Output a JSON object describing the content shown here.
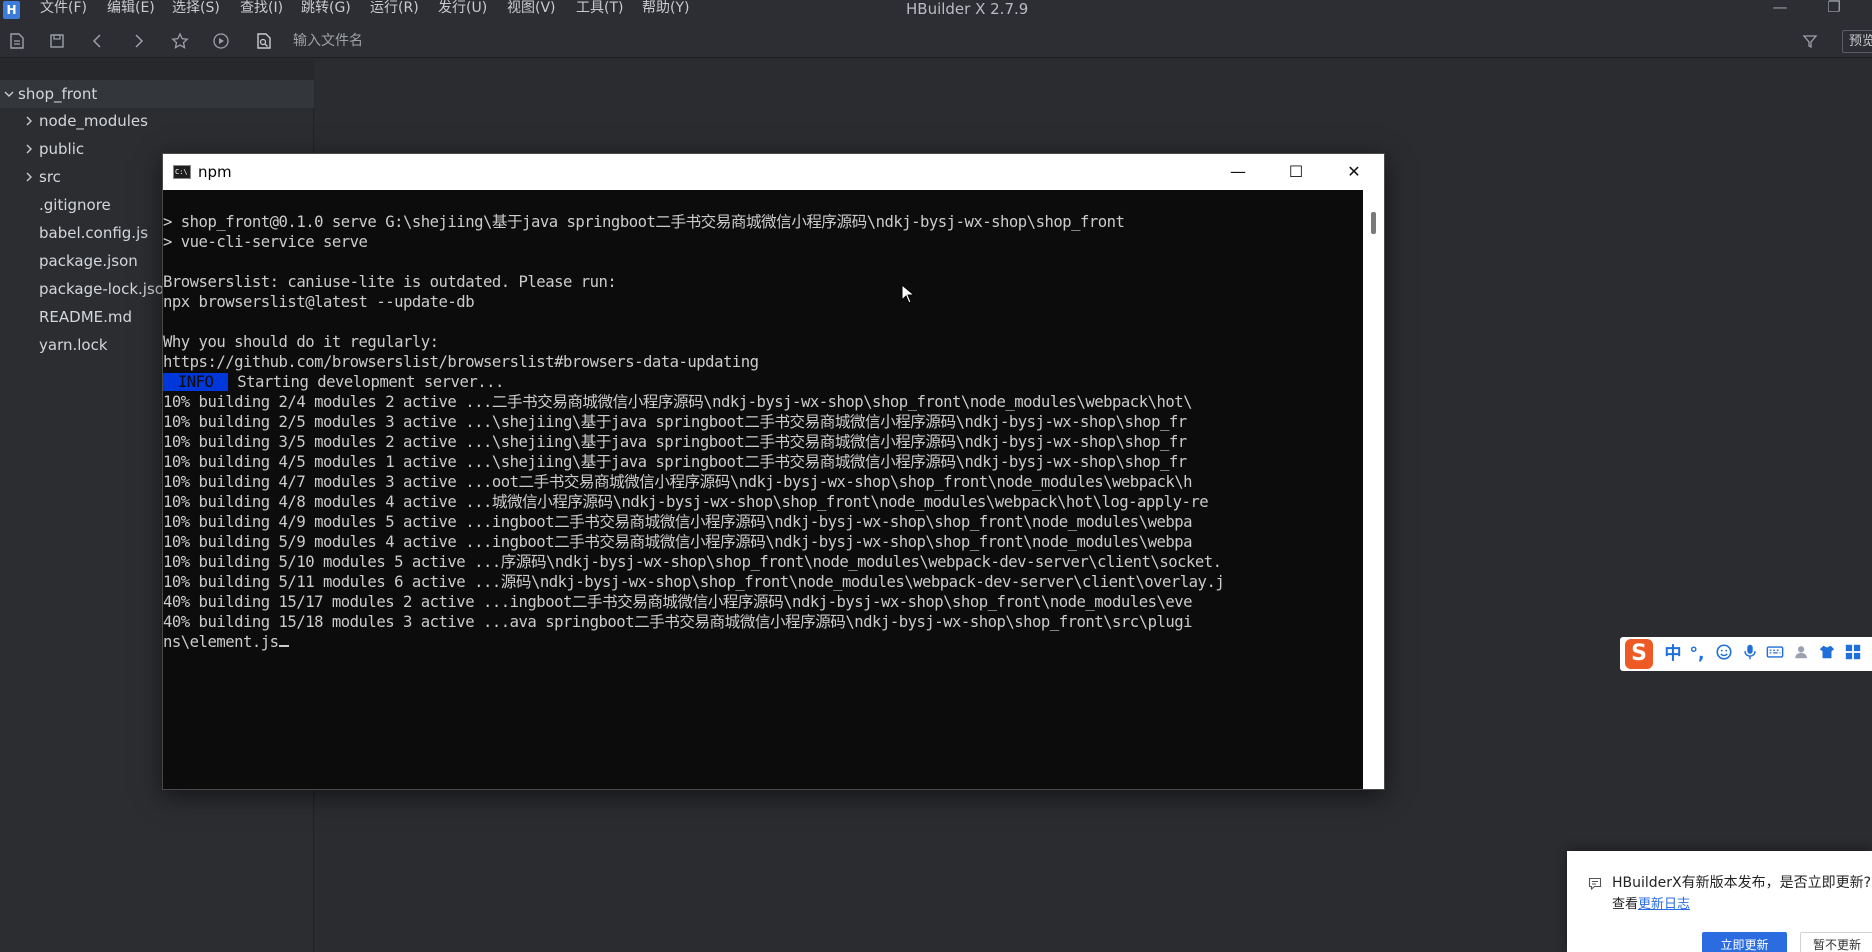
{
  "app": {
    "title": "HBuilder X 2.7.9",
    "logo_letter": "H"
  },
  "menu": [
    "文件(F)",
    "编辑(E)",
    "选择(S)",
    "查找(I)",
    "跳转(G)",
    "运行(R)",
    "发行(U)",
    "视图(V)",
    "工具(T)",
    "帮助(Y)"
  ],
  "window_controls": {
    "minimize": "—",
    "restore": "❐"
  },
  "toolbar": {
    "icons": [
      "new-file-icon",
      "save-icon",
      "back-icon",
      "forward-icon",
      "star-icon",
      "run-icon",
      "open-file-icon"
    ],
    "file_input_placeholder": "输入文件名",
    "preview_label": "预览"
  },
  "sidebar": {
    "project": "shop_front",
    "items": [
      {
        "label": "node_modules",
        "type": "folder"
      },
      {
        "label": "public",
        "type": "folder"
      },
      {
        "label": "src",
        "type": "folder"
      },
      {
        "label": ".gitignore",
        "type": "file"
      },
      {
        "label": "babel.config.js",
        "type": "file"
      },
      {
        "label": "package.json",
        "type": "file"
      },
      {
        "label": "package-lock.json",
        "type": "file"
      },
      {
        "label": "README.md",
        "type": "file"
      },
      {
        "label": "yarn.lock",
        "type": "file"
      }
    ]
  },
  "console": {
    "title": "npm",
    "icon_text": "C:\\",
    "controls": {
      "minimize": "—",
      "maximize": "☐",
      "close": "✕"
    },
    "lines": [
      "> shop_front@0.1.0 serve G:\\shejiing\\基于java springboot二手书交易商城微信小程序源码\\ndkj-bysj-wx-shop\\shop_front",
      "> vue-cli-service serve",
      "",
      "Browserslist: caniuse-lite is outdated. Please run:",
      "npx browserslist@latest --update-db",
      "",
      "Why you should do it regularly:",
      "https://github.com/browserslist/browserslist#browsers-data-updating",
      "",
      "10% building 2/4 modules 2 active ...二手书交易商城微信小程序源码\\ndkj-bysj-wx-shop\\shop_front\\node_modules\\webpack\\hot\\",
      "10% building 2/5 modules 3 active ...\\shejiing\\基于java springboot二手书交易商城微信小程序源码\\ndkj-bysj-wx-shop\\shop_fr",
      "10% building 3/5 modules 2 active ...\\shejiing\\基于java springboot二手书交易商城微信小程序源码\\ndkj-bysj-wx-shop\\shop_fr",
      "10% building 4/5 modules 1 active ...\\shejiing\\基于java springboot二手书交易商城微信小程序源码\\ndkj-bysj-wx-shop\\shop_fr",
      "10% building 4/7 modules 3 active ...oot二手书交易商城微信小程序源码\\ndkj-bysj-wx-shop\\shop_front\\node_modules\\webpack\\h",
      "10% building 4/8 modules 4 active ...城微信小程序源码\\ndkj-bysj-wx-shop\\shop_front\\node_modules\\webpack\\hot\\log-apply-re",
      "10% building 4/9 modules 5 active ...ingboot二手书交易商城微信小程序源码\\ndkj-bysj-wx-shop\\shop_front\\node_modules\\webpa",
      "10% building 5/9 modules 4 active ...ingboot二手书交易商城微信小程序源码\\ndkj-bysj-wx-shop\\shop_front\\node_modules\\webpa",
      "10% building 5/10 modules 5 active ...序源码\\ndkj-bysj-wx-shop\\shop_front\\node_modules\\webpack-dev-server\\client\\socket.",
      "10% building 5/11 modules 6 active ...源码\\ndkj-bysj-wx-shop\\shop_front\\node_modules\\webpack-dev-server\\client\\overlay.j",
      "40% building 15/17 modules 2 active ...ingboot二手书交易商城微信小程序源码\\ndkj-bysj-wx-shop\\shop_front\\node_modules\\eve",
      "40% building 15/18 modules 3 active ...ava springboot二手书交易商城微信小程序源码\\ndkj-bysj-wx-shop\\shop_front\\src\\plugi",
      "ns\\element.js"
    ],
    "info_badge": " INFO ",
    "info_text": " Starting development server..."
  },
  "ime": {
    "logo": "S",
    "mode": "中",
    "punct": "°,"
  },
  "notification": {
    "message": "HBuilderX有新版本发布，是否立即更新?",
    "sub_prefix": "查看",
    "link": "更新日志",
    "primary": "立即更新",
    "secondary": "暂不更新"
  },
  "colors": {
    "editor_bg": "#2a2c30",
    "console_bg": "#0c0c0c",
    "console_text": "#cccccc",
    "info_badge": "#0037da",
    "link": "#2b6de0"
  }
}
